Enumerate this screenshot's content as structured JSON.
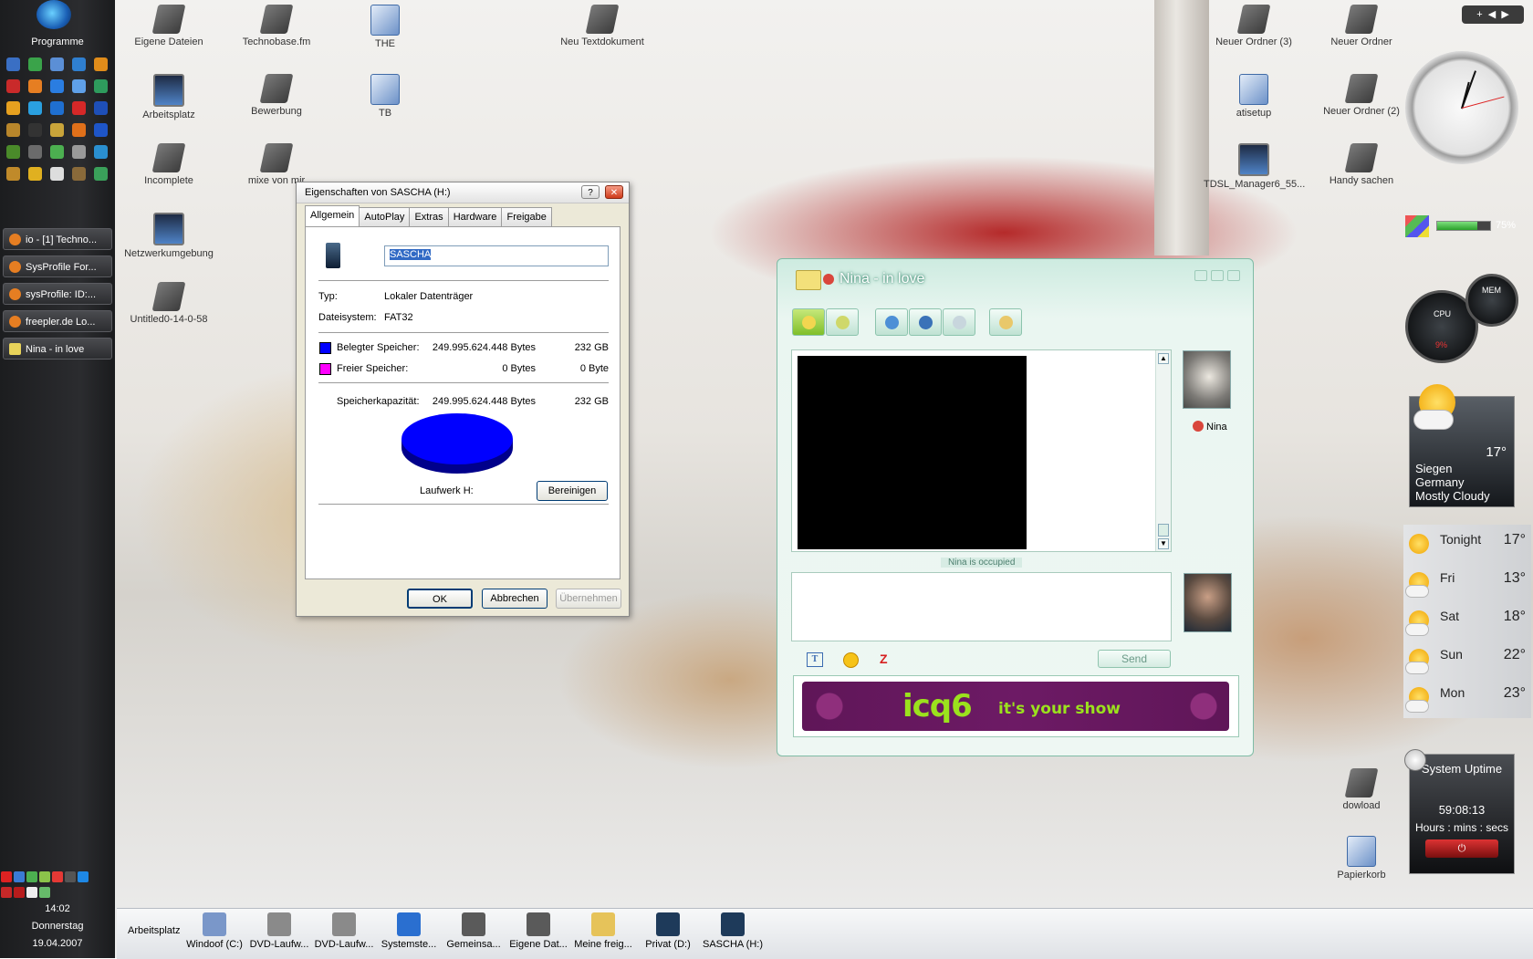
{
  "sidebar": {
    "programs_label": "Programme",
    "tasks": [
      {
        "label": "io - [1] Techno..."
      },
      {
        "label": "SysProfile For..."
      },
      {
        "label": "sysProfile: ID:..."
      },
      {
        "label": "freepler.de Lo..."
      },
      {
        "label": "Nina - in love"
      }
    ],
    "clock": {
      "time": "14:02",
      "day": "Donnerstag",
      "date": "19.04.2007"
    }
  },
  "desktop_icons": [
    {
      "label": "Eigene Dateien",
      "kind": "drive"
    },
    {
      "label": "Technobase.fm",
      "kind": "drive"
    },
    {
      "label": "THE",
      "kind": "doc"
    },
    {
      "label": "Neu Textdokument",
      "kind": "drive"
    },
    {
      "label": "Arbeitsplatz",
      "kind": "pc"
    },
    {
      "label": "Bewerbung",
      "kind": "drive"
    },
    {
      "label": "TB",
      "kind": "doc"
    },
    {
      "label": "Incomplete",
      "kind": "drive"
    },
    {
      "label": "mixe von mir",
      "kind": "drive"
    },
    {
      "label": "Netzwerkumgebung",
      "kind": "pc"
    },
    {
      "label": "Untitled0-14-0-58",
      "kind": "drive"
    },
    {
      "label": "Neuer Ordner (3)",
      "kind": "drive"
    },
    {
      "label": "Neuer Ordner",
      "kind": "drive"
    },
    {
      "label": "atisetup",
      "kind": "doc"
    },
    {
      "label": "Neuer Ordner (2)",
      "kind": "drive"
    },
    {
      "label": "TDSL_Manager6_55...",
      "kind": "pc"
    },
    {
      "label": "Handy sachen",
      "kind": "drive"
    },
    {
      "label": "dowload",
      "kind": "drive"
    },
    {
      "label": "Papierkorb",
      "kind": "doc"
    }
  ],
  "properties_dialog": {
    "title": "Eigenschaften von SASCHA (H:)",
    "help_button": "?",
    "close_button": "✕",
    "tabs": [
      "Allgemein",
      "AutoPlay",
      "Extras",
      "Hardware",
      "Freigabe"
    ],
    "active_tab": "Allgemein",
    "drive_name": "SASCHA",
    "type_label": "Typ:",
    "type_value": "Lokaler Datenträger",
    "fs_label": "Dateisystem:",
    "fs_value": "FAT32",
    "used_label": "Belegter Speicher:",
    "used_bytes": "249.995.624.448 Bytes",
    "used_size": "232 GB",
    "free_label": "Freier Speicher:",
    "free_bytes": "0 Bytes",
    "free_size": "0 Byte",
    "capacity_label": "Speicherkapazität:",
    "capacity_bytes": "249.995.624.448 Bytes",
    "capacity_size": "232 GB",
    "drive_caption": "Laufwerk H:",
    "cleanup_button": "Bereinigen",
    "ok_button": "OK",
    "cancel_button": "Abbrechen",
    "apply_button": "Übernehmen",
    "used_color": "#0000ff",
    "free_color": "#ff00ff"
  },
  "icq_window": {
    "title": "Nina - in love",
    "contact_name": "Nina",
    "status_text": "Nina is occupied",
    "send_button": "Send",
    "banner_brand": "icq6",
    "banner_slogan": "it's your show"
  },
  "gadgets": {
    "mem_percent_text": "75%",
    "mem_fraction": 0.75,
    "cpu_label": "CPU",
    "mem_label": "MEM",
    "cpu_percent_text": "9%",
    "weather": {
      "temp": "17°",
      "city": "Siegen",
      "country": "Germany",
      "condition": "Mostly Cloudy"
    },
    "forecast": [
      {
        "day": "Tonight",
        "temp": "17°",
        "icon": "sun-icon"
      },
      {
        "day": "Fri",
        "temp": "13°",
        "icon": "partly-cloudy-icon"
      },
      {
        "day": "Sat",
        "temp": "18°",
        "icon": "partly-cloudy-icon"
      },
      {
        "day": "Sun",
        "temp": "22°",
        "icon": "partly-cloudy-icon"
      },
      {
        "day": "Mon",
        "temp": "23°",
        "icon": "partly-cloudy-icon"
      }
    ],
    "uptime": {
      "title": "System Uptime",
      "value": "59:08:13",
      "caption": "Hours : mins : secs"
    }
  },
  "dock": {
    "label": "Arbeitsplatz",
    "items": [
      {
        "label": "Windoof (C:)"
      },
      {
        "label": "DVD-Laufw..."
      },
      {
        "label": "DVD-Laufw..."
      },
      {
        "label": "Systemste..."
      },
      {
        "label": "Gemeinsa..."
      },
      {
        "label": "Eigene Dat..."
      },
      {
        "label": "Meine freig..."
      },
      {
        "label": "Privat (D:)"
      },
      {
        "label": "SASCHA (H:)"
      }
    ]
  }
}
